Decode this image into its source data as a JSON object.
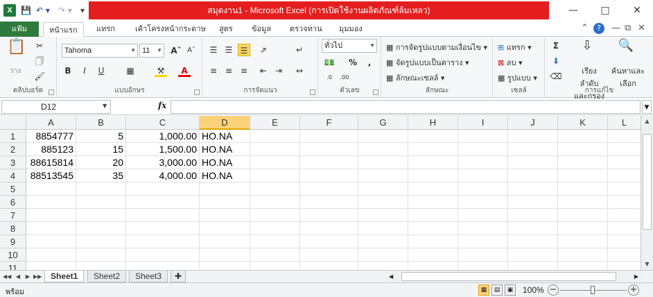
{
  "titlebar": {
    "app_icon": "X",
    "title": "สมุดงาน1 - Microsoft Excel (การเปิดใช้งานผลิตภัณฑ์ล้มเหลว)",
    "qat_icons": [
      "save-icon",
      "undo-icon",
      "redo-icon",
      "customize-icon"
    ]
  },
  "tabs": {
    "file": "แฟ้ม",
    "items": [
      "หน้าแรก",
      "แทรก",
      "เค้าโครงหน้ากระดาษ",
      "สูตร",
      "ข้อมูล",
      "ตรวจทาน",
      "มุมมอง"
    ],
    "active": "หน้าแรก"
  },
  "ribbon": {
    "clipboard": {
      "label": "คลิปบอร์ด",
      "paste": "วาง"
    },
    "font": {
      "label": "แบบอักษร",
      "name": "Tahoma",
      "size": "11",
      "bold": "B",
      "italic": "I",
      "underline": "U"
    },
    "alignment": {
      "label": "การจัดแนว"
    },
    "number": {
      "label": "ตัวเลข",
      "format": "ทั่วไป",
      "percent": "%",
      "comma": ","
    },
    "styles": {
      "label": "ลักษณะ",
      "conditional": "การจัดรูปแบบตามเงื่อนไข",
      "as_table": "จัดรูปแบบเป็นตาราง",
      "cell_styles": "ลักษณะเซลล์"
    },
    "cells": {
      "label": "เซลล์",
      "insert": "แทรก",
      "delete": "ลบ",
      "format": "รูปแบบ"
    },
    "editing": {
      "label": "การแก้ไข",
      "sort_filter_1": "เรียงลำดับ",
      "sort_filter_2": "และกรอง",
      "find_1": "ค้นหาและ",
      "find_2": "เลือก"
    }
  },
  "formula_bar": {
    "name_box": "D12",
    "fx": "fx",
    "formula": ""
  },
  "sheet": {
    "columns": [
      "A",
      "B",
      "C",
      "D",
      "E",
      "F",
      "G",
      "H",
      "I",
      "J",
      "K",
      "L"
    ],
    "active_column": "D",
    "active_row": "12",
    "row_numbers": [
      "1",
      "2",
      "3",
      "4",
      "5",
      "6",
      "7",
      "8",
      "9",
      "10",
      "11"
    ],
    "rows": [
      [
        "8854777",
        "5",
        "1,000.00",
        "HO.NA"
      ],
      [
        "885123",
        "15",
        "1,500.00",
        "HO.NA"
      ],
      [
        "88615814",
        "20",
        "3,000.00",
        "HO.NA"
      ],
      [
        "88513545",
        "35",
        "4,000.00",
        "HO.NA"
      ]
    ]
  },
  "sheet_tabs": [
    "Sheet1",
    "Sheet2",
    "Sheet3"
  ],
  "active_sheet": "Sheet1",
  "status": {
    "ready": "พร้อม",
    "zoom": "100%",
    "zoom_minus": "−",
    "zoom_plus": "+"
  }
}
